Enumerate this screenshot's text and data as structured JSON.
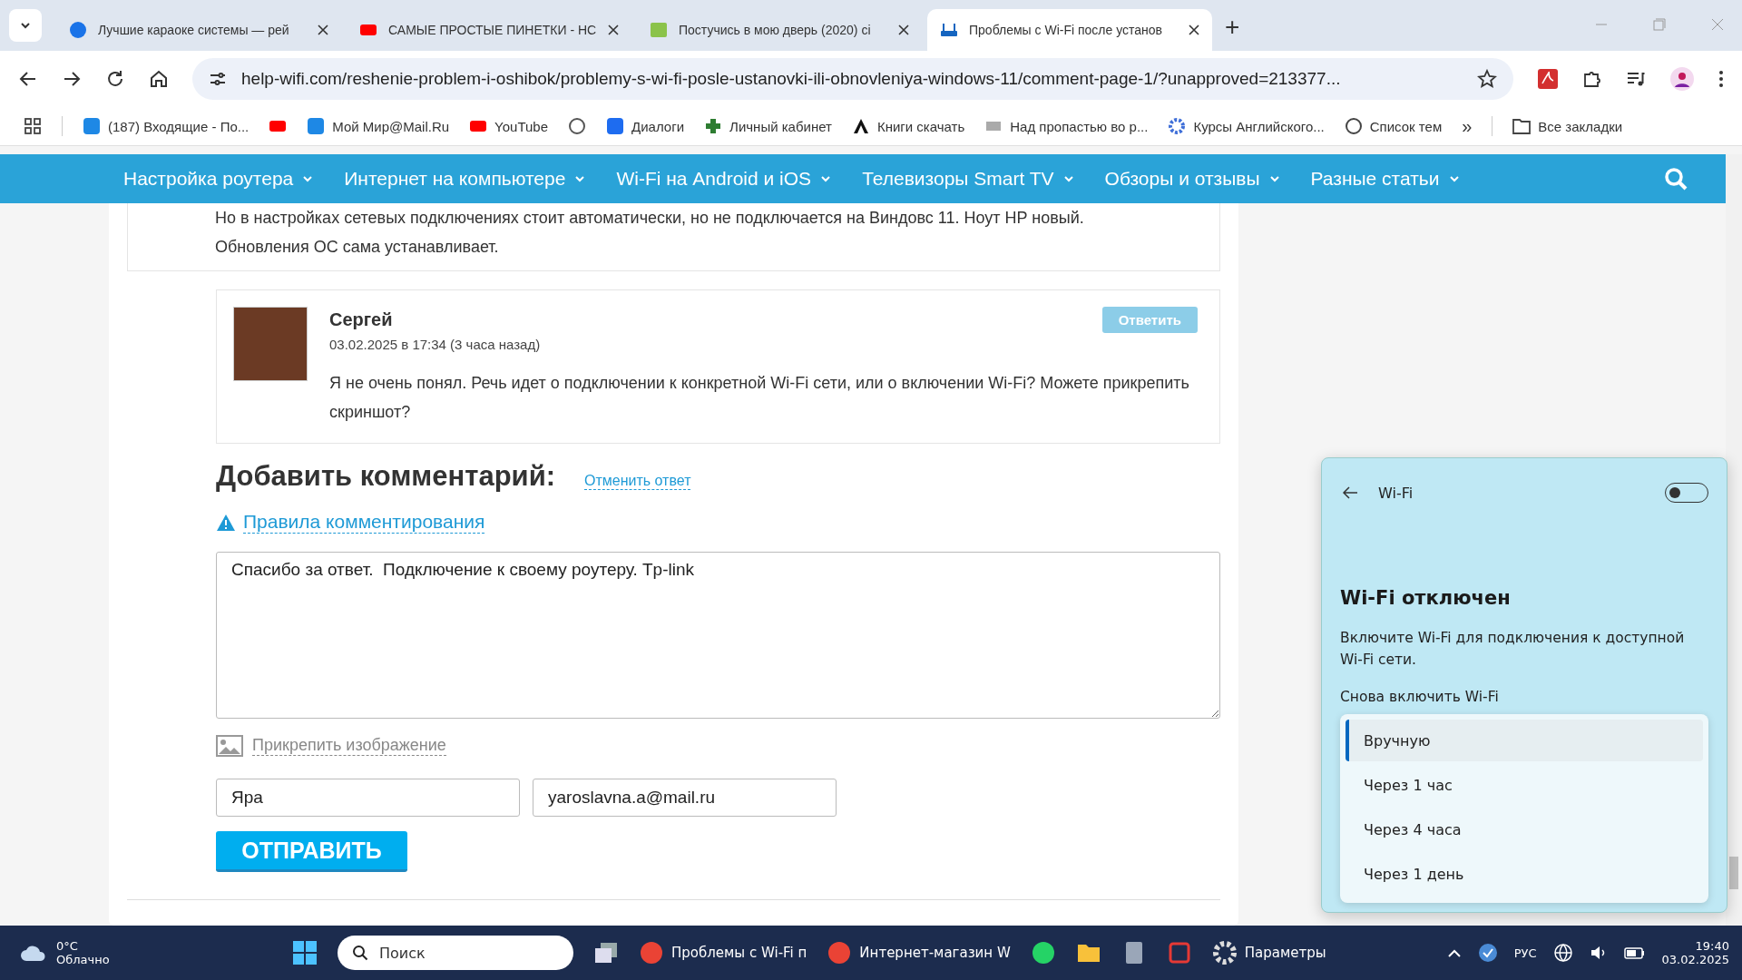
{
  "browser": {
    "tabs": [
      {
        "title": "Лучшие караоке системы — рей",
        "kind": "g-logo",
        "selected": false
      },
      {
        "title": "САМЫЕ ПРОСТЫЕ ПИНЕТКИ - НС",
        "kind": "video",
        "selected": false
      },
      {
        "title": "Постучись в мою дверь (2020) сі",
        "kind": "hd",
        "selected": false
      },
      {
        "title": "Проблемы с Wi-Fi после установ",
        "kind": "router",
        "selected": true
      }
    ],
    "new_tab": "+",
    "url": "help-wifi.com/reshenie-problem-i-oshibok/problemy-s-wi-fi-posle-ustanovki-ili-obnovleniya-windows-11/comment-page-1/?unapproved=213377...",
    "bookmarks": [
      {
        "label": "(187) Входящие - По...",
        "kind": "mail"
      },
      {
        "kind": "video"
      },
      {
        "label": "Мой Мир@Mail.Ru",
        "kind": "face"
      },
      {
        "label": "YouTube",
        "kind": "video"
      },
      {
        "kind": "globe"
      },
      {
        "label": "Диалоги",
        "kind": "chat"
      },
      {
        "label": "Личный кабинет",
        "kind": "cross"
      },
      {
        "label": "Книги скачать",
        "kind": "letter"
      },
      {
        "label": "Над пропастью во р...",
        "kind": "book"
      },
      {
        "label": "Курсы Английского...",
        "kind": "gear"
      },
      {
        "label": "Список тем",
        "kind": "arrow"
      }
    ],
    "more": "»",
    "all_bookmarks": "Все закладки"
  },
  "site_nav": {
    "items": [
      "Настройка роутера",
      "Интернет на компьютере",
      "Wi-Fi на Android и iOS",
      "Телевизоры Smart TV",
      "Обзоры и отзывы",
      "Разные статьи"
    ]
  },
  "previous_comment": {
    "text": "Но в настройках сетевых подключениях стоит автоматически, но не подключается на Виндовс 11. Ноут HP новый. Обновления ОС сама устанавливает."
  },
  "reply_comment": {
    "author": "Сергей",
    "date": "03.02.2025 в 17:34 (3 часа назад)",
    "reply_button": "Ответить",
    "text": "Я не очень понял. Речь идет о подключении к конкретной Wi-Fi сети, или о включении Wi-Fi? Можете прикрепить скриншот?"
  },
  "comment_form": {
    "heading": "Добавить комментарий:",
    "cancel_link": "Отменить ответ",
    "rules_link": "Правила комментирования",
    "message": "Спасибо за ответ.  Подключение к своему роутеру. Tp-link",
    "attach_link": "Прикрепить изображение",
    "name": "Яра",
    "email": "yaroslavna.a@mail.ru",
    "submit": "ОТПРАВИТЬ"
  },
  "wifi_flyout": {
    "title": "Wi-Fi",
    "on": false,
    "heading": "Wi-Fi отключен",
    "description": "Включите Wi-Fi для подключения к доступной Wi-Fi сети.",
    "label": "Снова включить Wi-Fi",
    "options": [
      {
        "label": "Вручную",
        "selected": true
      },
      {
        "label": "Через 1 час",
        "selected": false
      },
      {
        "label": "Через 4 часа",
        "selected": false
      },
      {
        "label": "Через 1 день",
        "selected": false
      }
    ]
  },
  "taskbar": {
    "weather": {
      "temp": "0°C",
      "condition": "Облачно"
    },
    "search_placeholder": "Поиск",
    "apps": [
      {
        "label": "Проблемы с Wi-Fi п",
        "kind": "browser"
      },
      {
        "label": "Интернет-магазин W",
        "kind": "browser"
      },
      {
        "kind": "whatsapp"
      },
      {
        "kind": "folder"
      },
      {
        "kind": "calculator"
      },
      {
        "kind": "snip"
      },
      {
        "label": "Параметры",
        "kind": "gear"
      }
    ],
    "language": "РУС",
    "time": "19:40",
    "date": "03.02.2025"
  }
}
